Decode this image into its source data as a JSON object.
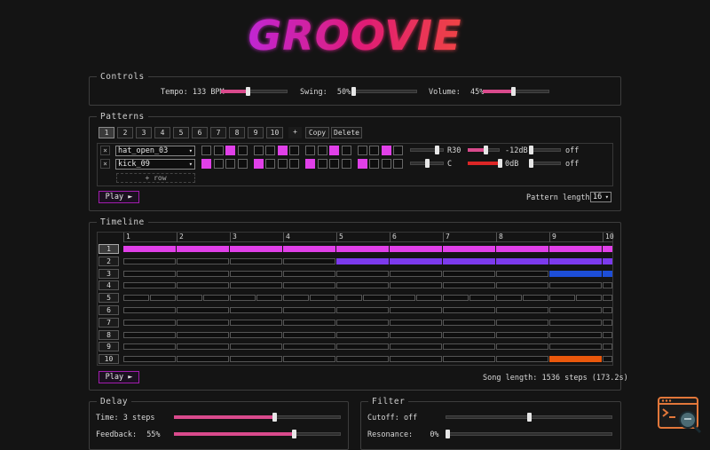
{
  "app": {
    "logo_text": "GROOVIE"
  },
  "colors": {
    "accent": "#e040e8",
    "purple": "#7c3aed",
    "blue": "#1d4ed8",
    "orange": "#ea580c",
    "red": "#dc2626",
    "pink_slider": "#d94a8c"
  },
  "controls": {
    "legend": "Controls",
    "tempo": {
      "label": "Tempo:",
      "value": "133 BPM",
      "level": 0.4
    },
    "swing": {
      "label": "Swing:",
      "value": "50%",
      "level": 0.0
    },
    "volume": {
      "label": "Volume:",
      "value": "45%",
      "level": 0.45
    }
  },
  "patterns": {
    "legend": "Patterns",
    "tabs": [
      "1",
      "2",
      "3",
      "4",
      "5",
      "6",
      "7",
      "8",
      "9",
      "10"
    ],
    "active_tab": "1",
    "add_label": "+",
    "copy_label": "Copy",
    "delete_label": "Delete",
    "remove_label": "×",
    "rows": [
      {
        "instrument": "hat_open_03",
        "steps": [
          0,
          0,
          1,
          0,
          0,
          0,
          1,
          0,
          0,
          0,
          1,
          0,
          0,
          0,
          1,
          0
        ],
        "pan_label": "R30",
        "pan": 0.8,
        "gain_label": "-12dB",
        "gain": 0.55,
        "gain_color": "#d94a8c",
        "filter_label": "off",
        "filter": 0.0
      },
      {
        "instrument": "kick_09",
        "steps": [
          1,
          0,
          0,
          0,
          1,
          0,
          0,
          0,
          1,
          0,
          0,
          0,
          1,
          0,
          0,
          0
        ],
        "pan_label": "C",
        "pan": 0.5,
        "gain_label": "0dB",
        "gain": 1.0,
        "gain_color": "#dc2626",
        "filter_label": "off",
        "filter": 0.0
      }
    ],
    "add_row_label": "+ row",
    "play_label": "Play ►",
    "length_label": "Pattern length:",
    "length_value": "16"
  },
  "timeline": {
    "legend": "Timeline",
    "bar_numbers": [
      "1",
      "2",
      "3",
      "4",
      "5",
      "6",
      "7",
      "8",
      "9",
      "10"
    ],
    "rows": [
      "1",
      "2",
      "3",
      "4",
      "5",
      "6",
      "7",
      "8",
      "9",
      "10"
    ],
    "active_row": "1",
    "play_label": "Play ►",
    "song_length": "Song length: 1536 steps (173.2s)"
  },
  "delay": {
    "legend": "Delay",
    "time": {
      "label": "Time: 3 steps",
      "level": 0.6
    },
    "feedback": {
      "label": "Feedback:",
      "value": "55%",
      "level": 0.72
    }
  },
  "filter": {
    "legend": "Filter",
    "cutoff": {
      "label": "Cutoff: off",
      "level": 0.5
    },
    "resonance": {
      "label": "Resonance:",
      "value": "0%",
      "level": 0.0
    }
  },
  "icons": {
    "extension": "terminal-search-icon"
  }
}
